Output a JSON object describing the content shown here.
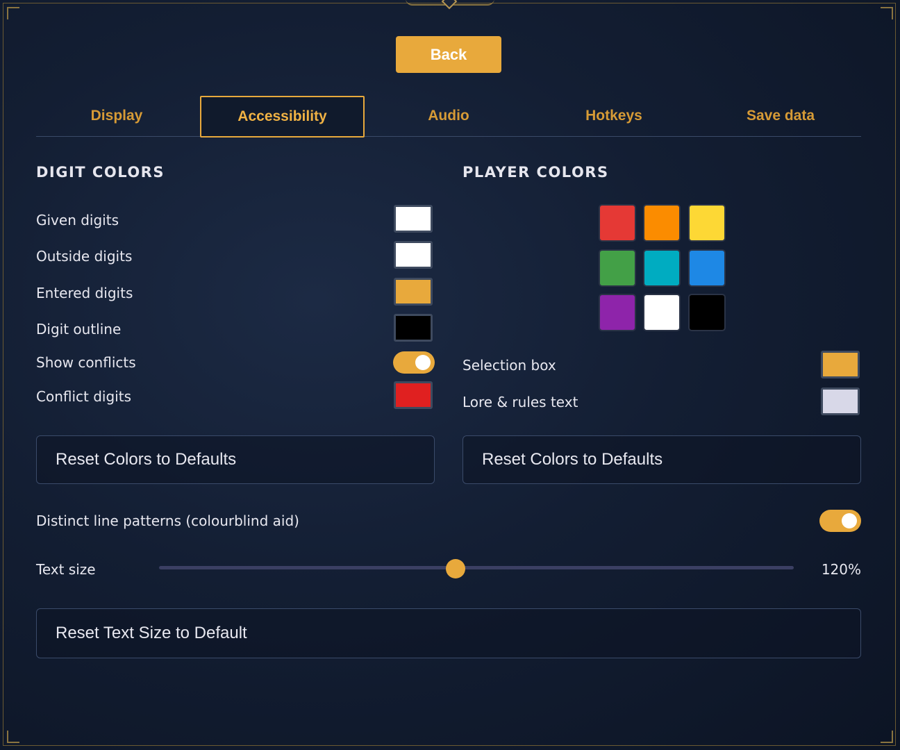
{
  "back_label": "Back",
  "tabs": [
    {
      "label": "Display",
      "active": false
    },
    {
      "label": "Accessibility",
      "active": true
    },
    {
      "label": "Audio",
      "active": false
    },
    {
      "label": "Hotkeys",
      "active": false
    },
    {
      "label": "Save data",
      "active": false
    }
  ],
  "digit_colors": {
    "title": "DIGIT COLORS",
    "rows": [
      {
        "label": "Given digits",
        "type": "swatch",
        "color": "#ffffff"
      },
      {
        "label": "Outside digits",
        "type": "swatch",
        "color": "#ffffff"
      },
      {
        "label": "Entered digits",
        "type": "swatch",
        "color": "#e8a93c"
      },
      {
        "label": "Digit outline",
        "type": "swatch",
        "color": "#000000"
      },
      {
        "label": "Show conflicts",
        "type": "toggle",
        "on": true
      },
      {
        "label": "Conflict digits",
        "type": "swatch",
        "color": "#e02020"
      }
    ],
    "reset_label": "Reset Colors to Defaults"
  },
  "player_colors": {
    "title": "PLAYER COLORS",
    "palette": [
      "#e53935",
      "#fb8c00",
      "#fdd835",
      "#43a047",
      "#00acc1",
      "#1e88e5",
      "#8e24aa",
      "#ffffff",
      "#000000"
    ],
    "rows": [
      {
        "label": "Selection box",
        "color": "#e8a93c"
      },
      {
        "label": "Lore & rules text",
        "color": "#d8d8e8"
      }
    ],
    "reset_label": "Reset Colors to Defaults"
  },
  "line_patterns": {
    "label": "Distinct line patterns (colourblind aid)",
    "on": true
  },
  "text_size": {
    "label": "Text size",
    "value": 120,
    "display": "120%"
  },
  "reset_text_label": "Reset Text Size to Default"
}
